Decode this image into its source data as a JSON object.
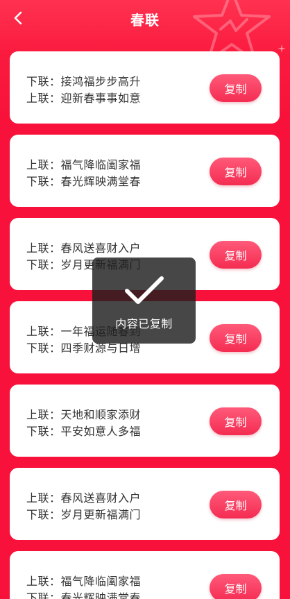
{
  "nav": {
    "title": "春联",
    "back_icon": "chevron-left-icon"
  },
  "cards": [
    {
      "line1": "下联：接鸿福步步高升",
      "line2": "上联：迎新春事事如意",
      "button": "复制"
    },
    {
      "line1": "上联：福气降临阖家福",
      "line2": "下联：春光辉映满堂春",
      "button": "复制"
    },
    {
      "line1": "上联：春风送喜财入户",
      "line2": "下联：岁月更新福满门",
      "button": "复制"
    },
    {
      "line1": "上联：一年福运随春到",
      "line2": "下联：四季财源与日增",
      "button": "复制"
    },
    {
      "line1": "上联：天地和顺家添财",
      "line2": "下联：平安如意人多福",
      "button": "复制"
    },
    {
      "line1": "上联：春风送喜财入户",
      "line2": "下联：岁月更新福满门",
      "button": "复制"
    },
    {
      "line1": "上联：福气降临阖家福",
      "line2": "下联：春光辉映满堂春",
      "button": "复制"
    }
  ],
  "toast": {
    "text": "内容已复制",
    "icon": "checkmark-icon"
  },
  "colors": {
    "primary": "#f8113a",
    "button": "#f42c52",
    "card": "#ffffff",
    "text": "#333333"
  }
}
